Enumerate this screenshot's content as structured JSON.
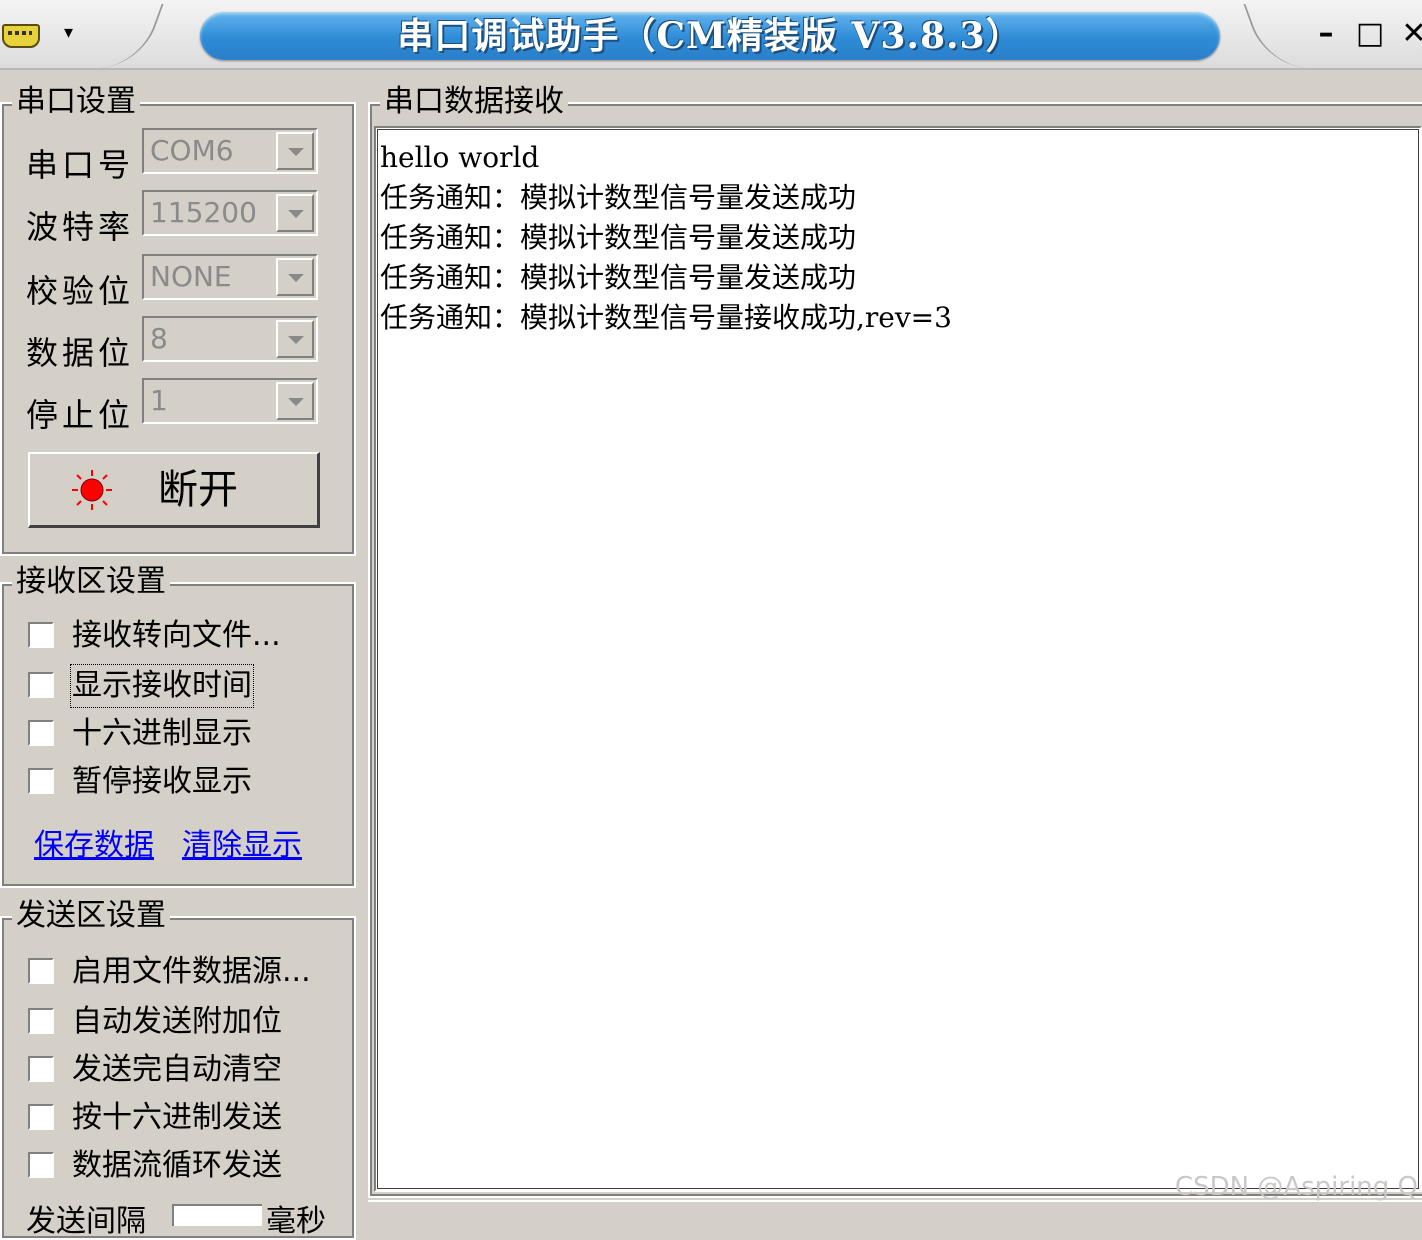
{
  "window": {
    "title": "串口调试助手（CM精装版 V3.8.3）",
    "menu_arrow": "▾",
    "min_label": "–",
    "max_label": "□",
    "close_label": "✕"
  },
  "port_settings": {
    "title": "串口设置",
    "rows": [
      {
        "label": "串口号",
        "value": "COM6"
      },
      {
        "label": "波特率",
        "value": "115200"
      },
      {
        "label": "校验位",
        "value": "NONE"
      },
      {
        "label": "数据位",
        "value": "8"
      },
      {
        "label": "停止位",
        "value": "1"
      }
    ],
    "connect_button": "断开",
    "led_color": "#ff0000"
  },
  "recv_settings": {
    "title": "接收区设置",
    "options": [
      "接收转向文件...",
      "显示接收时间",
      "十六进制显示",
      "暂停接收显示"
    ],
    "save_link": "保存数据",
    "clear_link": "清除显示"
  },
  "send_settings": {
    "title": "发送区设置",
    "options": [
      "启用文件数据源...",
      "自动发送附加位",
      "发送完自动清空",
      "按十六进制发送",
      "数据流循环发送"
    ],
    "interval_label": "发送间隔",
    "interval_unit": "毫秒"
  },
  "recv_data": {
    "title": "串口数据接收",
    "lines": [
      "hello world",
      "任务通知：模拟计数型信号量发送成功",
      "任务通知：模拟计数型信号量发送成功",
      "任务通知：模拟计数型信号量发送成功",
      "任务通知：模拟计数型信号量接收成功,rev=3"
    ]
  },
  "watermark": "CSDN @Aspiring Q"
}
